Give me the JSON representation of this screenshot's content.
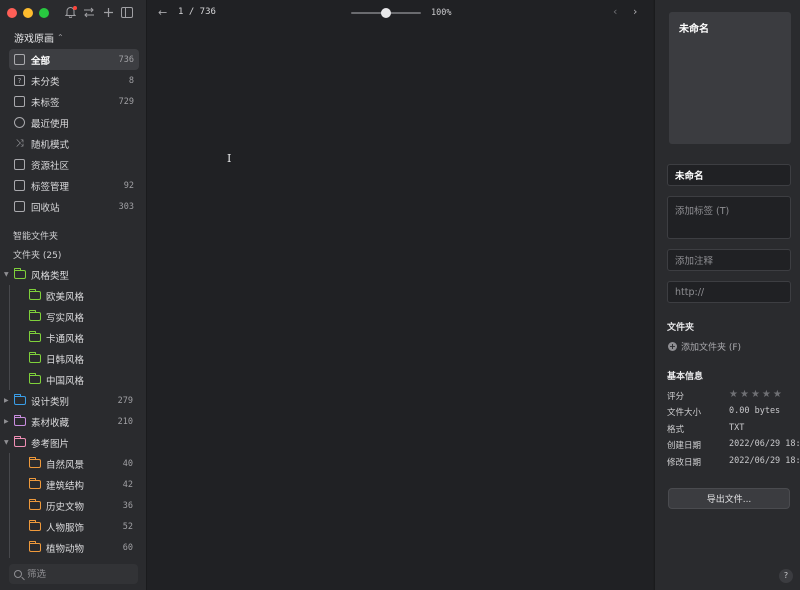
{
  "sidebar": {
    "library_name": "游戏原画",
    "nav": [
      {
        "label": "全部",
        "count": "736",
        "icon": "inbox-icon",
        "active": true
      },
      {
        "label": "未分类",
        "count": "8",
        "icon": "unsorted-icon"
      },
      {
        "label": "未标签",
        "count": "729",
        "icon": "untagged-icon"
      },
      {
        "label": "最近使用",
        "count": "",
        "icon": "clock-icon"
      },
      {
        "label": "随机模式",
        "count": "",
        "icon": "shuffle-icon"
      },
      {
        "label": "资源社区",
        "count": "",
        "icon": "community-icon"
      },
      {
        "label": "标签管理",
        "count": "92",
        "icon": "bookmark-icon"
      },
      {
        "label": "回收站",
        "count": "303",
        "icon": "trash-icon"
      }
    ],
    "smart_folders_title": "智能文件夹",
    "folders_title": "文件夹 (25)",
    "folders": [
      {
        "label": "风格类型",
        "count": "",
        "color": "#7fd13b",
        "level": 0,
        "arrow": "expanded"
      },
      {
        "label": "欧美风格",
        "count": "",
        "color": "#7fd13b",
        "level": 1
      },
      {
        "label": "写实风格",
        "count": "",
        "color": "#7fd13b",
        "level": 1
      },
      {
        "label": "卡通风格",
        "count": "",
        "color": "#7fd13b",
        "level": 1
      },
      {
        "label": "日韩风格",
        "count": "",
        "color": "#7fd13b",
        "level": 1
      },
      {
        "label": "中国风格",
        "count": "",
        "color": "#7fd13b",
        "level": 1
      },
      {
        "label": "设计类别",
        "count": "279",
        "color": "#3a9ee8",
        "level": 0,
        "arrow": "collapsed"
      },
      {
        "label": "素材收藏",
        "count": "210",
        "color": "#c98ee0",
        "level": 0,
        "arrow": "collapsed"
      },
      {
        "label": "参考图片",
        "count": "",
        "color": "#ef8fb5",
        "level": 0,
        "arrow": "expanded"
      },
      {
        "label": "自然风景",
        "count": "40",
        "color": "#ef9a3c",
        "level": 1
      },
      {
        "label": "建筑结构",
        "count": "42",
        "color": "#ef9a3c",
        "level": 1
      },
      {
        "label": "历史文物",
        "count": "36",
        "color": "#ef9a3c",
        "level": 1
      },
      {
        "label": "人物服饰",
        "count": "52",
        "color": "#ef9a3c",
        "level": 1
      },
      {
        "label": "植物动物",
        "count": "60",
        "color": "#ef9a3c",
        "level": 1
      }
    ],
    "filter_placeholder": "筛选"
  },
  "toolbar": {
    "pager": "1 / 736",
    "zoom_label": "100%",
    "zoom_level": 0.5
  },
  "inspector": {
    "preview_title": "未命名",
    "name_value": "未命名",
    "tags_placeholder": "添加标签 (T)",
    "note_placeholder": "添加注释",
    "url_placeholder": "http://",
    "folder_section_title": "文件夹",
    "add_folder_label": "添加文件夹 (F)",
    "basic_info_title": "基本信息",
    "info": {
      "rating_label": "评分",
      "rating_value": 0,
      "size_label": "文件大小",
      "size_value": "0.00 bytes",
      "format_label": "格式",
      "format_value": "TXT",
      "created_label": "创建日期",
      "created_value": "2022/06/29 18:",
      "modified_label": "修改日期",
      "modified_value": "2022/06/29 18:"
    },
    "export_label": "导出文件...",
    "help_label": "?"
  }
}
